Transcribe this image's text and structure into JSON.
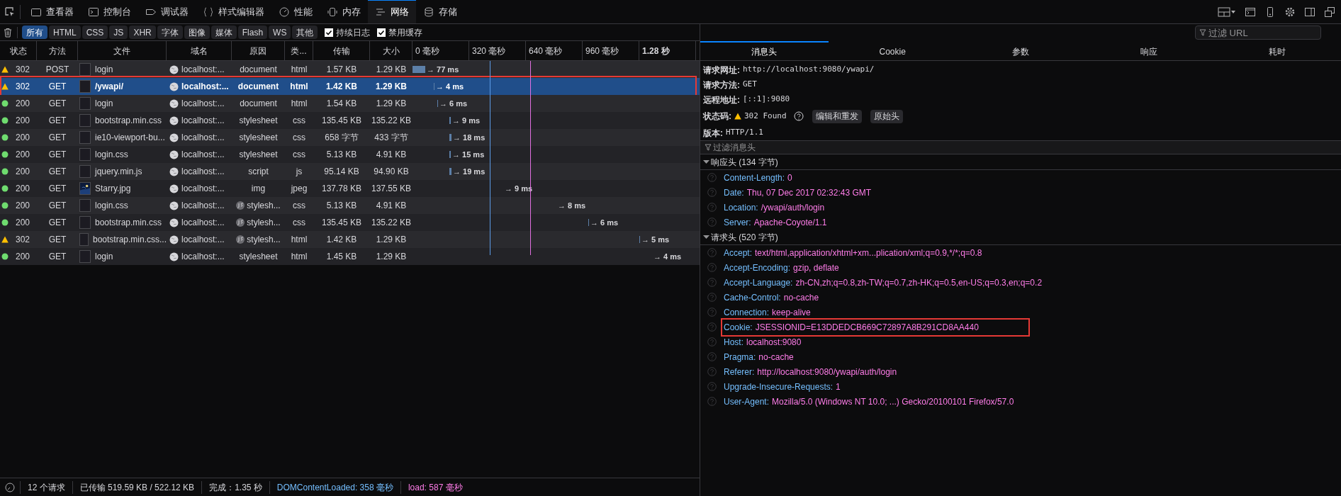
{
  "toolbar": {
    "tabs": [
      {
        "label": "查看器",
        "selected": false
      },
      {
        "label": "控制台",
        "selected": false
      },
      {
        "label": "调试器",
        "selected": false
      },
      {
        "label": "样式编辑器",
        "selected": false
      },
      {
        "label": "性能",
        "selected": false
      },
      {
        "label": "内存",
        "selected": false
      },
      {
        "label": "网络",
        "selected": true
      },
      {
        "label": "存储",
        "selected": false
      }
    ]
  },
  "filter_bar": {
    "types": [
      {
        "label": "所有",
        "selected": true
      },
      {
        "label": "HTML",
        "selected": false
      },
      {
        "label": "CSS",
        "selected": false
      },
      {
        "label": "JS",
        "selected": false
      },
      {
        "label": "XHR",
        "selected": false
      },
      {
        "label": "字体",
        "selected": false
      },
      {
        "label": "图像",
        "selected": false
      },
      {
        "label": "媒体",
        "selected": false
      },
      {
        "label": "Flash",
        "selected": false
      },
      {
        "label": "WS",
        "selected": false
      },
      {
        "label": "其他",
        "selected": false
      }
    ],
    "options": [
      {
        "label": "持续日志",
        "checked": true
      },
      {
        "label": "禁用缓存",
        "checked": true
      }
    ],
    "url_filter": {
      "placeholder": "过滤 URL"
    }
  },
  "table": {
    "columns": [
      "状态",
      "方法",
      "文件",
      "域名",
      "原因",
      "类...",
      "传输",
      "大小"
    ],
    "timeline_ticks": [
      "0 毫秒",
      "320 毫秒",
      "640 毫秒",
      "960 毫秒",
      "1.28 秒"
    ],
    "rows": [
      {
        "kind": "warning",
        "status": "302",
        "method": "POST",
        "file": "login",
        "domain": "localhost:...",
        "cause": "document",
        "cause_js": false,
        "type": "html",
        "transferred": "1.57 KB",
        "size": "1.29 KB",
        "timing": "→ 77 ms",
        "selected": false,
        "highlighted": false
      },
      {
        "kind": "warning",
        "status": "302",
        "method": "GET",
        "file": "/ywapi/",
        "domain": "localhost:...",
        "cause": "document",
        "cause_js": false,
        "type": "html",
        "transferred": "1.42 KB",
        "size": "1.29 KB",
        "timing": "→ 4 ms",
        "selected": true,
        "highlighted": true
      },
      {
        "kind": "success",
        "status": "200",
        "method": "GET",
        "file": "login",
        "domain": "localhost:...",
        "cause": "document",
        "cause_js": false,
        "type": "html",
        "transferred": "1.54 KB",
        "size": "1.29 KB",
        "timing": "→ 6 ms",
        "selected": false,
        "highlighted": false
      },
      {
        "kind": "success",
        "status": "200",
        "method": "GET",
        "file": "bootstrap.min.css",
        "domain": "localhost:...",
        "cause": "stylesheet",
        "cause_js": false,
        "type": "css",
        "transferred": "135.45 KB",
        "size": "135.22 KB",
        "timing": "→ 9 ms",
        "selected": false,
        "highlighted": false
      },
      {
        "kind": "success",
        "status": "200",
        "method": "GET",
        "file": "ie10-viewport-bu...",
        "domain": "localhost:...",
        "cause": "stylesheet",
        "cause_js": false,
        "type": "css",
        "transferred": "658 字节",
        "size": "433 字节",
        "timing": "→ 18 ms",
        "selected": false,
        "highlighted": false
      },
      {
        "kind": "success",
        "status": "200",
        "method": "GET",
        "file": "login.css",
        "domain": "localhost:...",
        "cause": "stylesheet",
        "cause_js": false,
        "type": "css",
        "transferred": "5.13 KB",
        "size": "4.91 KB",
        "timing": "→ 15 ms",
        "selected": false,
        "highlighted": false
      },
      {
        "kind": "success",
        "status": "200",
        "method": "GET",
        "file": "jquery.min.js",
        "domain": "localhost:...",
        "cause": "script",
        "cause_js": false,
        "type": "js",
        "transferred": "95.14 KB",
        "size": "94.90 KB",
        "timing": "→ 19 ms",
        "selected": false,
        "highlighted": false
      },
      {
        "kind": "success",
        "status": "200",
        "method": "GET",
        "file": "Starry.jpg",
        "domain": "localhost:...",
        "cause": "img",
        "cause_js": false,
        "type": "jpeg",
        "transferred": "137.78 KB",
        "size": "137.55 KB",
        "timing": "→ 9 ms",
        "selected": false,
        "highlighted": false
      },
      {
        "kind": "success",
        "status": "200",
        "method": "GET",
        "file": "login.css",
        "domain": "localhost:...",
        "cause": "stylesh...",
        "cause_js": true,
        "type": "css",
        "transferred": "5.13 KB",
        "size": "4.91 KB",
        "timing": "→ 8 ms",
        "selected": false,
        "highlighted": false
      },
      {
        "kind": "success",
        "status": "200",
        "method": "GET",
        "file": "bootstrap.min.css",
        "domain": "localhost:...",
        "cause": "stylesh...",
        "cause_js": true,
        "type": "css",
        "transferred": "135.45 KB",
        "size": "135.22 KB",
        "timing": "→ 6 ms",
        "selected": false,
        "highlighted": false
      },
      {
        "kind": "warning",
        "status": "302",
        "method": "GET",
        "file": "bootstrap.min.css...",
        "domain": "localhost:...",
        "cause": "stylesh...",
        "cause_js": true,
        "type": "html",
        "transferred": "1.42 KB",
        "size": "1.29 KB",
        "timing": "→ 5 ms",
        "selected": false,
        "highlighted": false
      },
      {
        "kind": "success",
        "status": "200",
        "method": "GET",
        "file": "login",
        "domain": "localhost:...",
        "cause": "stylesheet",
        "cause_js": false,
        "type": "html",
        "transferred": "1.45 KB",
        "size": "1.29 KB",
        "timing": "→ 4 ms",
        "selected": false,
        "highlighted": false
      }
    ]
  },
  "status_bar": {
    "requests": "12 个请求",
    "transferred": "已传输 519.59 KB / 522.12 KB",
    "finish": "完成：1.35 秒",
    "dom_content_loaded": "DOMContentLoaded: 358 毫秒",
    "load": "load: 587 毫秒"
  },
  "details": {
    "tabs": [
      {
        "label": "消息头",
        "selected": true
      },
      {
        "label": "Cookie",
        "selected": false
      },
      {
        "label": "参数",
        "selected": false
      },
      {
        "label": "响应",
        "selected": false
      },
      {
        "label": "耗时",
        "selected": false
      }
    ],
    "summary": [
      {
        "label": "请求网址:",
        "value": "http://localhost:9080/ywapi/"
      },
      {
        "label": "请求方法:",
        "value": "GET"
      },
      {
        "label": "远程地址:",
        "value": "[::1]:9080"
      }
    ],
    "status_code": {
      "label": "状态码:",
      "value": "302 Found",
      "buttons": [
        "编辑和重发",
        "原始头"
      ]
    },
    "version": {
      "label": "版本:",
      "value": "HTTP/1.1"
    },
    "header_filter": {
      "placeholder": "过滤消息头"
    },
    "sections": [
      {
        "title": "响应头 (134 字节)",
        "expanded": true,
        "headers": [
          {
            "name": "Content-Length:",
            "value": "0",
            "highlighted": false
          },
          {
            "name": "Date:",
            "value": "Thu, 07 Dec 2017 02:32:43 GMT",
            "highlighted": false
          },
          {
            "name": "Location:",
            "value": "/ywapi/auth/login",
            "highlighted": false
          },
          {
            "name": "Server:",
            "value": "Apache-Coyote/1.1",
            "highlighted": false
          }
        ]
      },
      {
        "title": "请求头 (520 字节)",
        "expanded": true,
        "headers": [
          {
            "name": "Accept:",
            "value": "text/html,application/xhtml+xm...plication/xml;q=0.9,*/*;q=0.8",
            "highlighted": false
          },
          {
            "name": "Accept-Encoding:",
            "value": "gzip, deflate",
            "highlighted": false
          },
          {
            "name": "Accept-Language:",
            "value": "zh-CN,zh;q=0.8,zh-TW;q=0.7,zh-HK;q=0.5,en-US;q=0.3,en;q=0.2",
            "highlighted": false
          },
          {
            "name": "Cache-Control:",
            "value": "no-cache",
            "highlighted": false
          },
          {
            "name": "Connection:",
            "value": "keep-alive",
            "highlighted": false
          },
          {
            "name": "Cookie:",
            "value": "JSESSIONID=E13DDEDCB669C72897A8B291CD8AA440",
            "highlighted": true
          },
          {
            "name": "Host:",
            "value": "localhost:9080",
            "highlighted": false
          },
          {
            "name": "Pragma:",
            "value": "no-cache",
            "highlighted": false
          },
          {
            "name": "Referer:",
            "value": "http://localhost:9080/ywapi/auth/login",
            "highlighted": false
          },
          {
            "name": "Upgrade-Insecure-Requests:",
            "value": "1",
            "highlighted": false
          },
          {
            "name": "User-Agent:",
            "value": "Mozilla/5.0 (Windows NT 10.0; ...) Gecko/20100101 Firefox/57.0",
            "highlighted": false
          }
        ]
      }
    ]
  }
}
